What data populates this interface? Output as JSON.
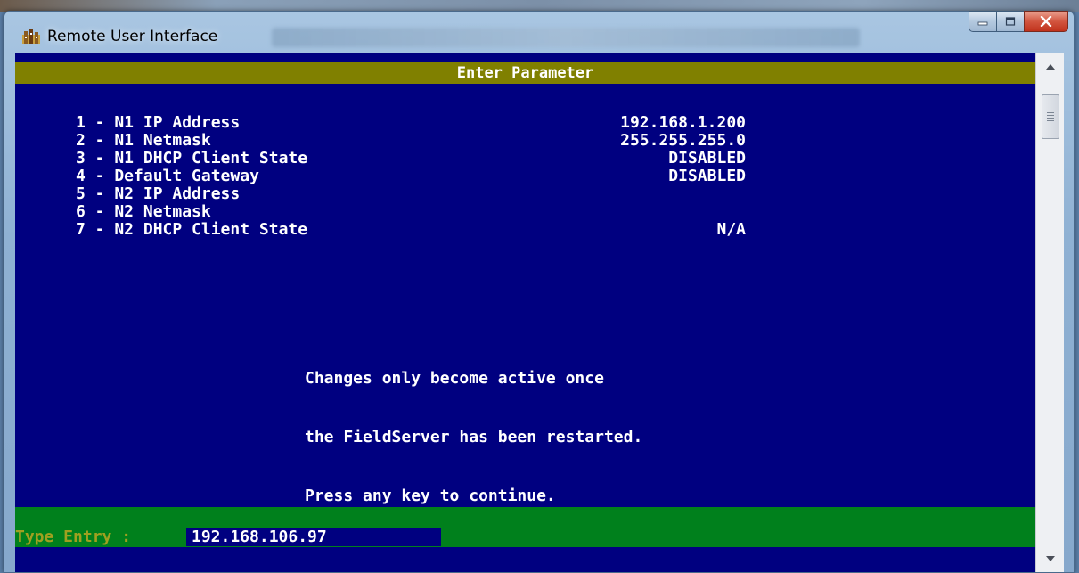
{
  "window": {
    "title": "Remote User Interface"
  },
  "terminal": {
    "header": "Enter Parameter",
    "params": [
      {
        "label": "1 - N1 IP Address",
        "value": "192.168.1.200"
      },
      {
        "label": "2 - N1 Netmask",
        "value": "255.255.255.0"
      },
      {
        "label": "3 - N1 DHCP Client State",
        "value": "DISABLED"
      },
      {
        "label": "4 - Default Gateway",
        "value": "DISABLED"
      },
      {
        "label": "5 - N2 IP Address",
        "value": ""
      },
      {
        "label": "6 - N2 Netmask",
        "value": ""
      },
      {
        "label": "7 - N2 DHCP Client State",
        "value": "N/A"
      }
    ],
    "message": [
      "Changes only become active once",
      "the FieldServer has been restarted.",
      "Press any key to continue."
    ],
    "entry_label": "Type Entry : ",
    "entry_value": "192.168.106.97"
  },
  "colors": {
    "terminal_bg": "#000080",
    "header_bar": "#808000",
    "entry_bar": "#00801c",
    "text": "#ffffff"
  },
  "icons": {
    "app": "building-icon",
    "minimize": "minimize-icon",
    "maximize": "maximize-icon",
    "close": "close-icon",
    "scroll_up": "chevron-up-icon",
    "scroll_down": "chevron-down-icon"
  }
}
